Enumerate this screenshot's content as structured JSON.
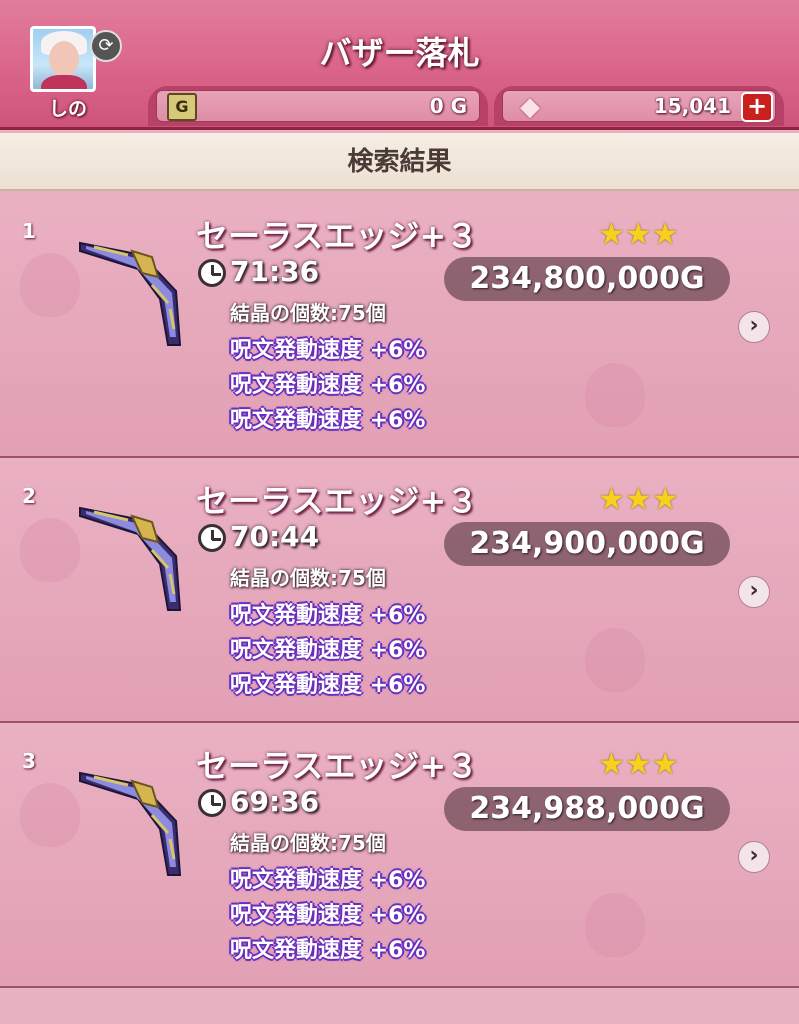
{
  "header": {
    "title": "バザー落札",
    "player_name": "しの",
    "gold_icon_letter": "G",
    "gold_value": "0 G",
    "gem_value": "15,041",
    "plus_label": "+"
  },
  "section_title": "検索結果",
  "listings": [
    {
      "number": "1",
      "name": "セーラスエッジ+３",
      "stars": "★★★",
      "star_rating": 3,
      "time": "71:36",
      "price": "234,800,000G",
      "crystals": "結晶の個数:75個",
      "effects": [
        "呪文発動速度 +6%",
        "呪文発動速度 +6%",
        "呪文発動速度 +6%"
      ]
    },
    {
      "number": "2",
      "name": "セーラスエッジ+３",
      "stars": "★★★",
      "star_rating": 3,
      "time": "70:44",
      "price": "234,900,000G",
      "crystals": "結晶の個数:75個",
      "effects": [
        "呪文発動速度 +6%",
        "呪文発動速度 +6%",
        "呪文発動速度 +6%"
      ]
    },
    {
      "number": "3",
      "name": "セーラスエッジ+３",
      "stars": "★★★",
      "star_rating": 3,
      "time": "69:36",
      "price": "234,988,000G",
      "crystals": "結晶の個数:75個",
      "effects": [
        "呪文発動速度 +6%",
        "呪文発動速度 +6%",
        "呪文発動速度 +6%"
      ]
    }
  ],
  "icons": {
    "swap": "swap-icon",
    "gold": "gold-icon",
    "gem": "gem-icon",
    "clock": "clock-icon",
    "weapon": "boomerang-icon",
    "chevron": "chevron-right-icon"
  },
  "colors": {
    "header_pink": "#d96388",
    "row_pink": "#e2a0b4",
    "star_gold": "#f8d01e",
    "effect_purple": "#6a2fbf",
    "plus_red": "#c9201c"
  }
}
